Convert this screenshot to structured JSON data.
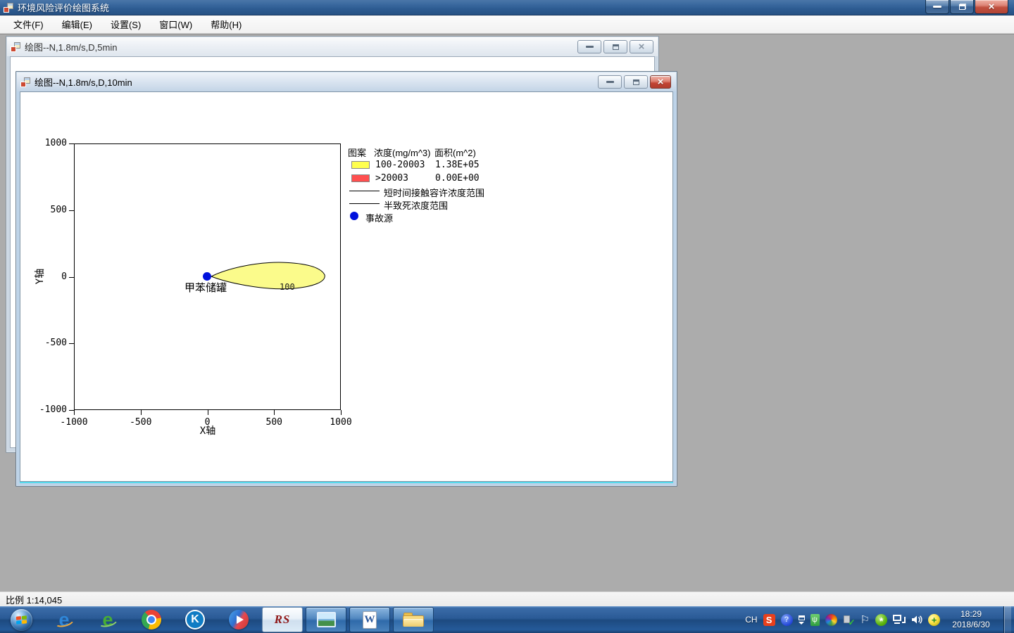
{
  "app": {
    "title": "环境风险评价绘图系统",
    "menu": [
      "文件(F)",
      "编辑(E)",
      "设置(S)",
      "窗口(W)",
      "帮助(H)"
    ]
  },
  "windows": {
    "back": {
      "title": "绘图--N,1.8m/s,D,5min"
    },
    "front": {
      "title": "绘图--N,1.8m/s,D,10min"
    }
  },
  "chart_data": {
    "type": "area",
    "title": "",
    "xlabel": "X轴",
    "ylabel": "Y轴",
    "xlim": [
      -1000,
      1000
    ],
    "ylim": [
      -1000,
      1000
    ],
    "xticks": [
      -1000,
      -500,
      0,
      500,
      1000
    ],
    "yticks": [
      1000,
      500,
      0,
      -500,
      -1000
    ],
    "grid": false,
    "source": {
      "label": "甲苯储罐",
      "x": 0,
      "y": 0,
      "color": "#0011dd"
    },
    "plume": {
      "contour_label": "100",
      "contour_value": 100,
      "fill": "#fbfb8b",
      "direction": "east",
      "extent_x": [
        30,
        900
      ],
      "half_width_y": [
        -95,
        105
      ]
    },
    "legend": {
      "header": {
        "pattern": "图案",
        "concentration": "浓度(mg/m^3)",
        "area": "面积(m^2)"
      },
      "rows": [
        {
          "color": "#ffff4f",
          "range": "100-20003",
          "area": "1.38E+05"
        },
        {
          "color": "#ff4f4f",
          "range": ">20003",
          "area": "0.00E+00"
        }
      ],
      "lines": [
        "短时间接触容许浓度范围",
        "半致死浓度范围"
      ],
      "point_label": "事故源",
      "point_color": "#0011dd"
    }
  },
  "statusbar": {
    "scale": "比例 1:14,045"
  },
  "taskbar": {
    "apps": [
      {
        "name": "risk-system",
        "label": "RS",
        "active": true
      },
      {
        "name": "image-viewer",
        "active": false
      },
      {
        "name": "word",
        "active": false
      },
      {
        "name": "file-explorer",
        "active": false
      }
    ],
    "tray": {
      "lang": "CH",
      "input_badge": "S",
      "clock": {
        "time": "18:29",
        "date": "2018/6/30"
      }
    }
  }
}
